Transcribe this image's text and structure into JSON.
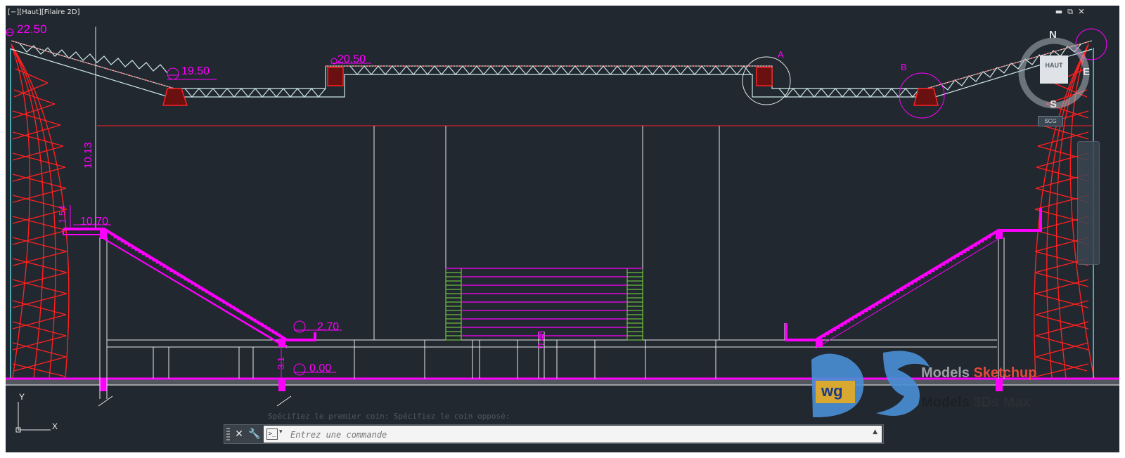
{
  "viewport": {
    "label": "[−][Haut][Filaire 2D]",
    "controls": {
      "minimize": "▬",
      "restore": "⧉",
      "close": "✕"
    }
  },
  "drawing": {
    "elevations": {
      "top_left": "22.50",
      "roof_mid_left": "19.50",
      "roof_center": "20.50",
      "stand_top": "10.70",
      "stand_bottom": "2.70",
      "ground": "0.00"
    },
    "dimensions": {
      "height": "10.13",
      "small_left": "1.54",
      "small_bottom": "3.1",
      "stage_step": "0.48"
    },
    "detail_labels": {
      "a": "A",
      "b": "B"
    },
    "colors": {
      "background": "#212830",
      "structure": "#ff2020",
      "truss": "#cfe8e8",
      "dimension": "#ff00ff",
      "stage_green": "#7fe040",
      "white_lines": "#e8e8e8"
    }
  },
  "viewcube": {
    "north": "N",
    "east": "E",
    "south": "S",
    "face": "HAUT",
    "ucs_menu": "SCG"
  },
  "ucs_icon": {
    "y": "Y",
    "x": "X"
  },
  "command_line": {
    "history": "Spécifiez le premier coin: Spécifiez le coin opposé:",
    "placeholder": "Entrez une commande",
    "close_icon": "✕",
    "customize_icon": "🔧",
    "prompt_icon": ">_",
    "dropdown_icon": "▲"
  },
  "watermark": {
    "logo_text": "wg",
    "line1_prefix": "Models ",
    "line1_brand": "Sketchup",
    "line2_prefix": "Models ",
    "line2_brand": "3Ds Max"
  }
}
